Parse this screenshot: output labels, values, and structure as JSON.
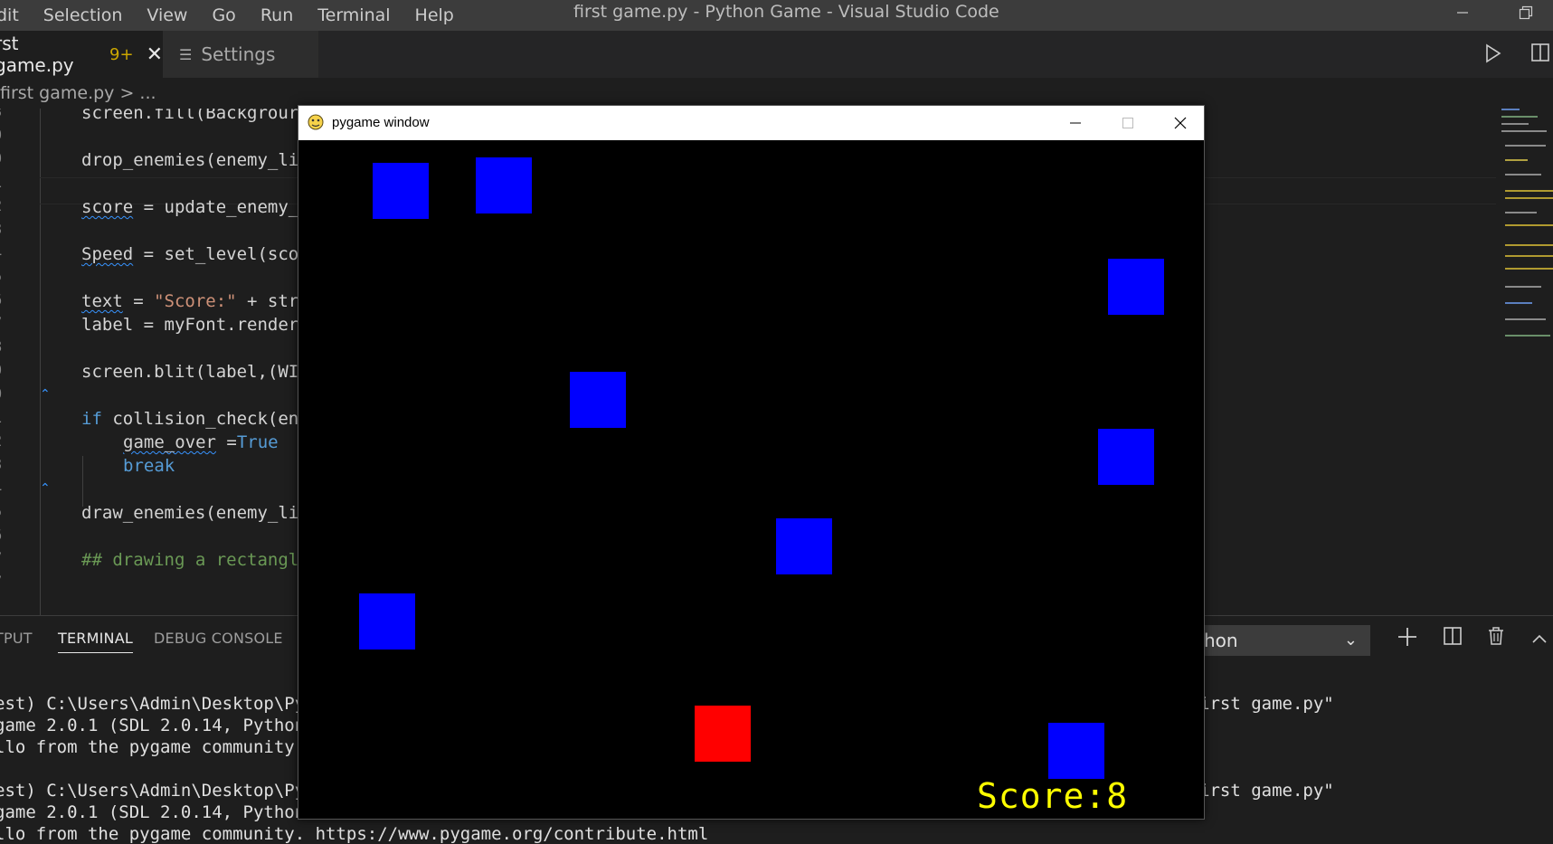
{
  "vscode": {
    "menu": [
      "dit",
      "Selection",
      "View",
      "Go",
      "Run",
      "Terminal",
      "Help"
    ],
    "window_title": "first game.py - Python Game - Visual Studio Code",
    "tabs": {
      "active_label": "rst game.py",
      "active_dirty": "9+",
      "settings_label": "Settings"
    },
    "breadcrumb": "first game.py > ...",
    "line_numbers": [
      "3",
      "9",
      "1",
      "2",
      "3",
      "4",
      "5",
      "6",
      "7",
      "8",
      "9",
      "0",
      "1",
      "2",
      "3",
      "4",
      "5",
      "6",
      "7"
    ],
    "code": {
      "l1": "screen.fill(Backgrour",
      "l2": "drop_enemies(enemy_li",
      "l3_var": "score",
      "l3_rest": " = update_enemy_",
      "l4_var": "Speed",
      "l4_rest": " = set_level(sco",
      "l5_var": "text",
      "l5_mid": " = ",
      "l5_str": "\"Score:\"",
      "l5_rest": " + str",
      "l6": "label = myFont.render",
      "l7": "screen.blit(label,(WI",
      "l8_kw": "if",
      "l8_rest": " collision_check(en",
      "l9_var": "game_over",
      "l9_mid": " =",
      "l9_kw": "True",
      "l10_kw": "break",
      "l11": "draw_enemies(enemy_li",
      "l12": "## drawing a rectangl"
    },
    "panel": {
      "tabs": [
        "TPUT",
        "TERMINAL",
        "DEBUG CONSOLE"
      ],
      "active_tab": "TERMINAL",
      "terminal_select": "hon",
      "terminal_lines_left": [
        "est) C:\\Users\\Admin\\Desktop\\Pyt",
        "game 2.0.1 (SDL 2.0.14, Python",
        "llo from the pygame community.",
        "",
        "est) C:\\Users\\Admin\\Desktop\\Pyt",
        "game 2.0.1 (SDL 2.0.14, Python",
        "llo from the pygame community. https://www.pygame.org/contribute.html"
      ],
      "terminal_lines_right": [
        "irst game.py\"",
        "irst game.py\""
      ]
    }
  },
  "pygame": {
    "title": "pygame window",
    "score_text": "Score:8",
    "colors": {
      "enemy": "#0000ff",
      "player": "#ff0000",
      "score": "#ffff00",
      "background": "#000000"
    }
  }
}
